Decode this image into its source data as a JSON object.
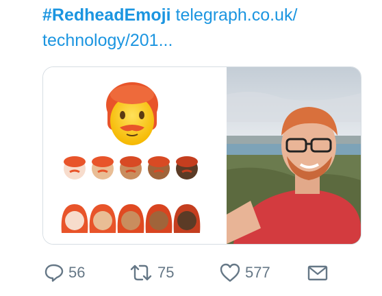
{
  "tweet": {
    "hashtag": "#RedheadEmoji",
    "link_line1": "telegraph.co.uk/",
    "link_line2": "technology/201..."
  },
  "media": {
    "left_image_desc": "red-haired emoji set",
    "right_image_desc": "selfie photo"
  },
  "actions": {
    "reply_count": "56",
    "retweet_count": "75",
    "like_count": "577"
  },
  "colors": {
    "link": "#1b95e0",
    "action_gray": "#657786",
    "border": "#d6dde3"
  }
}
